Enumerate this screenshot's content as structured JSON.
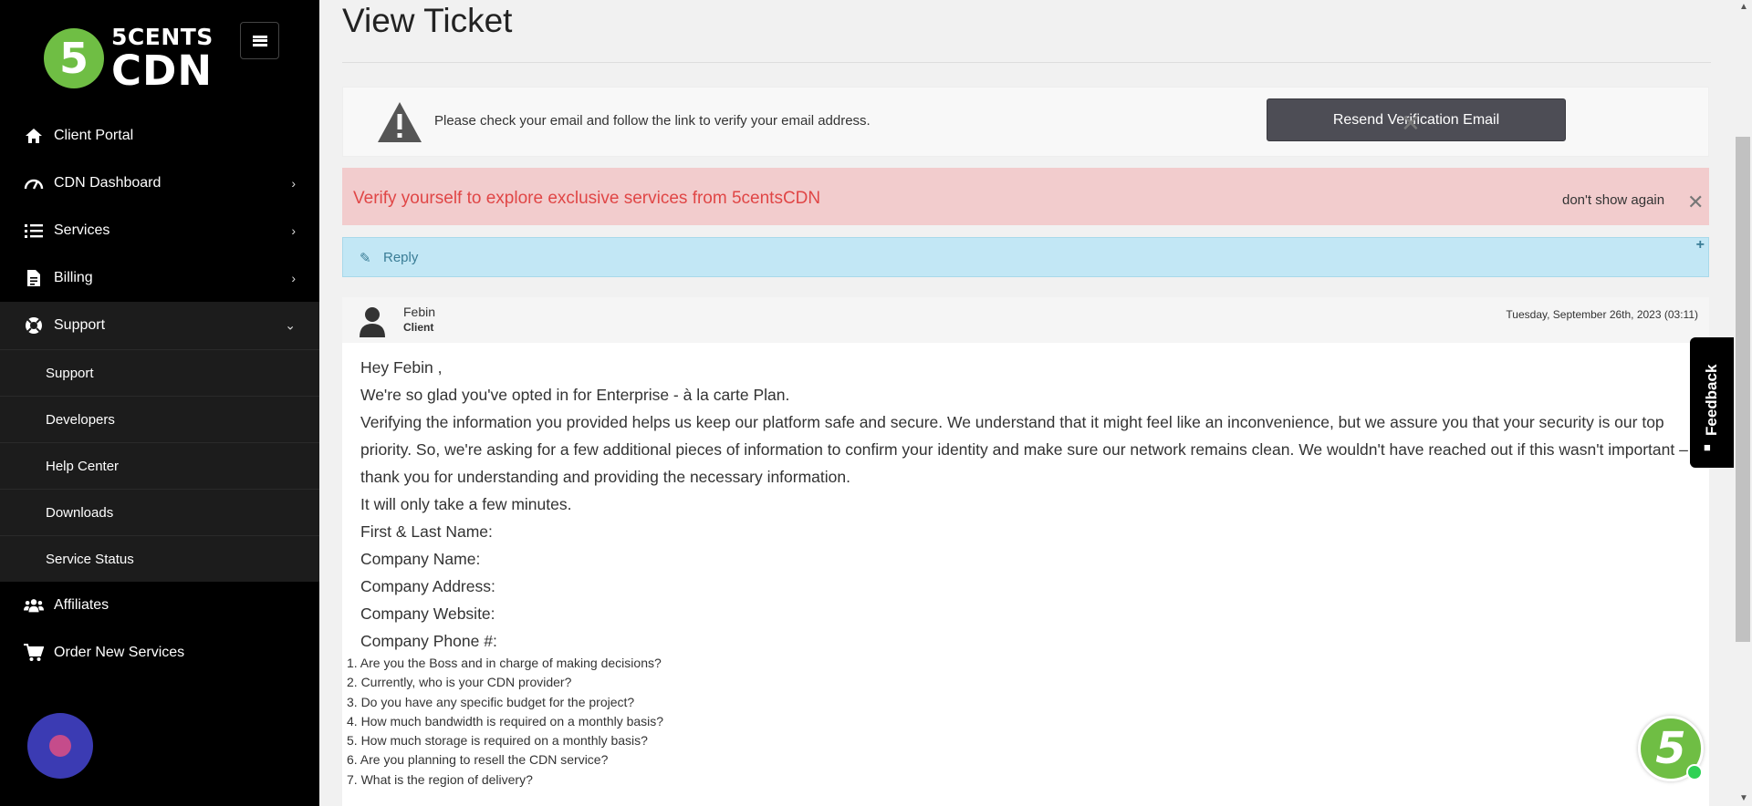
{
  "brand": {
    "logo_digit": "5",
    "line1": "5CENTS",
    "line2": "CDN",
    "color": "#6fbe44"
  },
  "sidebar": {
    "items": [
      {
        "label": "Client Portal",
        "icon": "home-icon"
      },
      {
        "label": "CDN Dashboard",
        "icon": "gauge-icon",
        "chevron": "›"
      },
      {
        "label": "Services",
        "icon": "list-icon",
        "chevron": "›"
      },
      {
        "label": "Billing",
        "icon": "document-icon",
        "chevron": "›"
      },
      {
        "label": "Support",
        "icon": "lifebuoy-icon",
        "chevron": "⌄",
        "expanded": true
      }
    ],
    "support_sub": [
      "Support",
      "Developers",
      "Help Center",
      "Downloads",
      "Service Status"
    ],
    "bottom_items": [
      {
        "label": "Affiliates",
        "icon": "users-icon"
      },
      {
        "label": "Order New Services",
        "icon": "cart-icon"
      }
    ]
  },
  "page": {
    "title": "View Ticket"
  },
  "verify_notice": {
    "text": "Please check your email and follow the link to verify your email address.",
    "button": "Resend Verification Email",
    "close": "✕"
  },
  "red_alert": {
    "text": "Verify yourself to explore exclusive services from 5centsCDN",
    "dismiss": "don't show again",
    "close": "✕"
  },
  "reply": {
    "label": "Reply",
    "pen": "✎",
    "plus": "+"
  },
  "message": {
    "author": "Febin",
    "role": "Client",
    "date": "Tuesday, September 26th, 2023 (03:11)",
    "greeting": "Hey Febin ,",
    "p1": "We're so glad you've opted in for Enterprise - à la carte Plan.",
    "p2": "Verifying the information you provided helps us keep our platform safe and secure. We understand that it might feel like an inconvenience, but we assure you that your security is our top priority. So, we're asking for a few additional pieces of information to confirm your identity and make sure our network remains clean. We wouldn't have reached out if this wasn't important – thank you for understanding and providing the necessary information.",
    "p3": "It will only take a few minutes.",
    "fields": [
      "First & Last Name:",
      "Company Name:",
      "Company Address:",
      "Company Website:",
      "Company Phone #:"
    ],
    "questions": [
      "1. Are you the Boss and in charge of making decisions?",
      "2. Currently, who is your CDN provider?",
      "3. Do you have any specific budget for the project?",
      "4. How much bandwidth is required on a monthly basis?",
      "5. How much storage is required on a monthly basis?",
      "6. Are you planning to resell the CDN service?",
      "7. What is the region of delivery?"
    ]
  },
  "feedback": {
    "label": "Feedback"
  },
  "chat": {
    "digit": "5"
  }
}
